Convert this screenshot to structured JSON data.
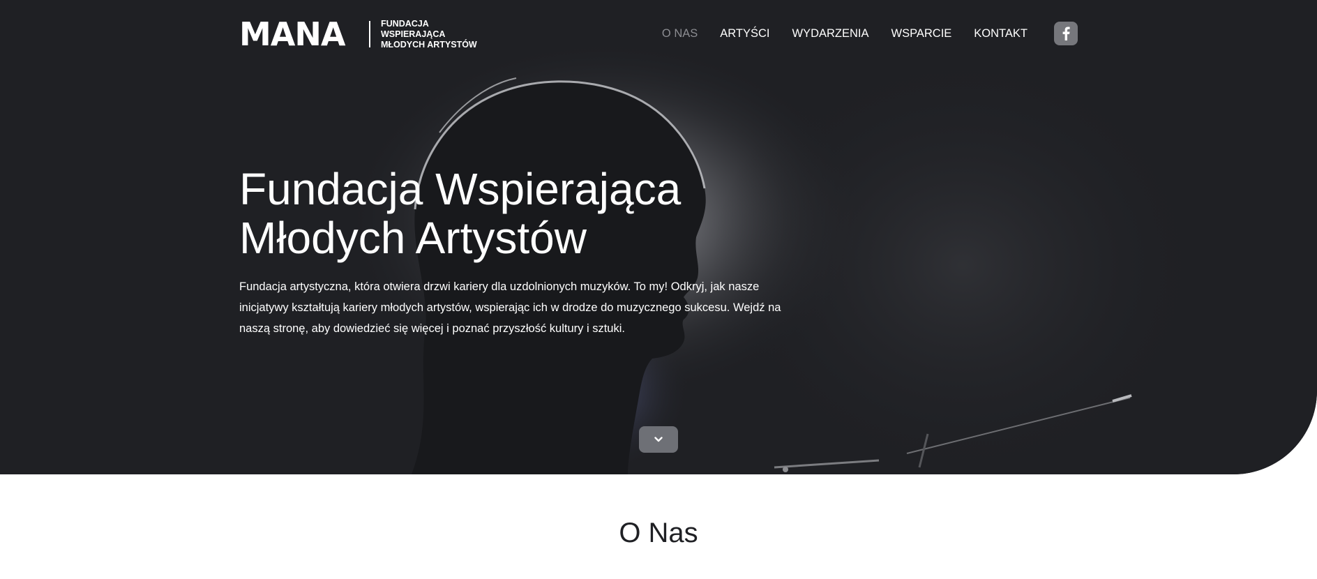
{
  "logo": {
    "word": "MANA",
    "sub_lines": [
      "FUNDACJA",
      "WSPIERAJĄCA",
      "MŁODYCH ARTYSTÓW"
    ]
  },
  "nav": {
    "items": [
      {
        "label": "O NAS",
        "active": true
      },
      {
        "label": "ARTYŚCI",
        "active": false
      },
      {
        "label": "WYDARZENIA",
        "active": false
      },
      {
        "label": "WSPARCIE",
        "active": false
      },
      {
        "label": "KONTAKT",
        "active": false
      }
    ],
    "social_icon": "facebook-icon"
  },
  "hero": {
    "title_lines": [
      "Fundacja Wspierająca",
      "Młodych Artystów"
    ],
    "description": "Fundacja artystyczna, która otwiera drzwi kariery dla uzdolnionych muzyków. To my! Odkryj, jak nasze inicjatywy kształtują kariery młodych artystów, wspierając ich w drodze do muzycznego sukcesu.  Wejdź na naszą stronę, aby dowiedzieć się więcej i poznać przyszłość kultury i sztuki.",
    "scroll_icon": "chevron-down-icon"
  },
  "about": {
    "title": "O Nas"
  },
  "colors": {
    "hero_background": "#1f2024",
    "nav_active": "#8c8d92",
    "button_background": "#76777c",
    "text_light": "#ffffff",
    "text_dark": "#1f2024"
  }
}
